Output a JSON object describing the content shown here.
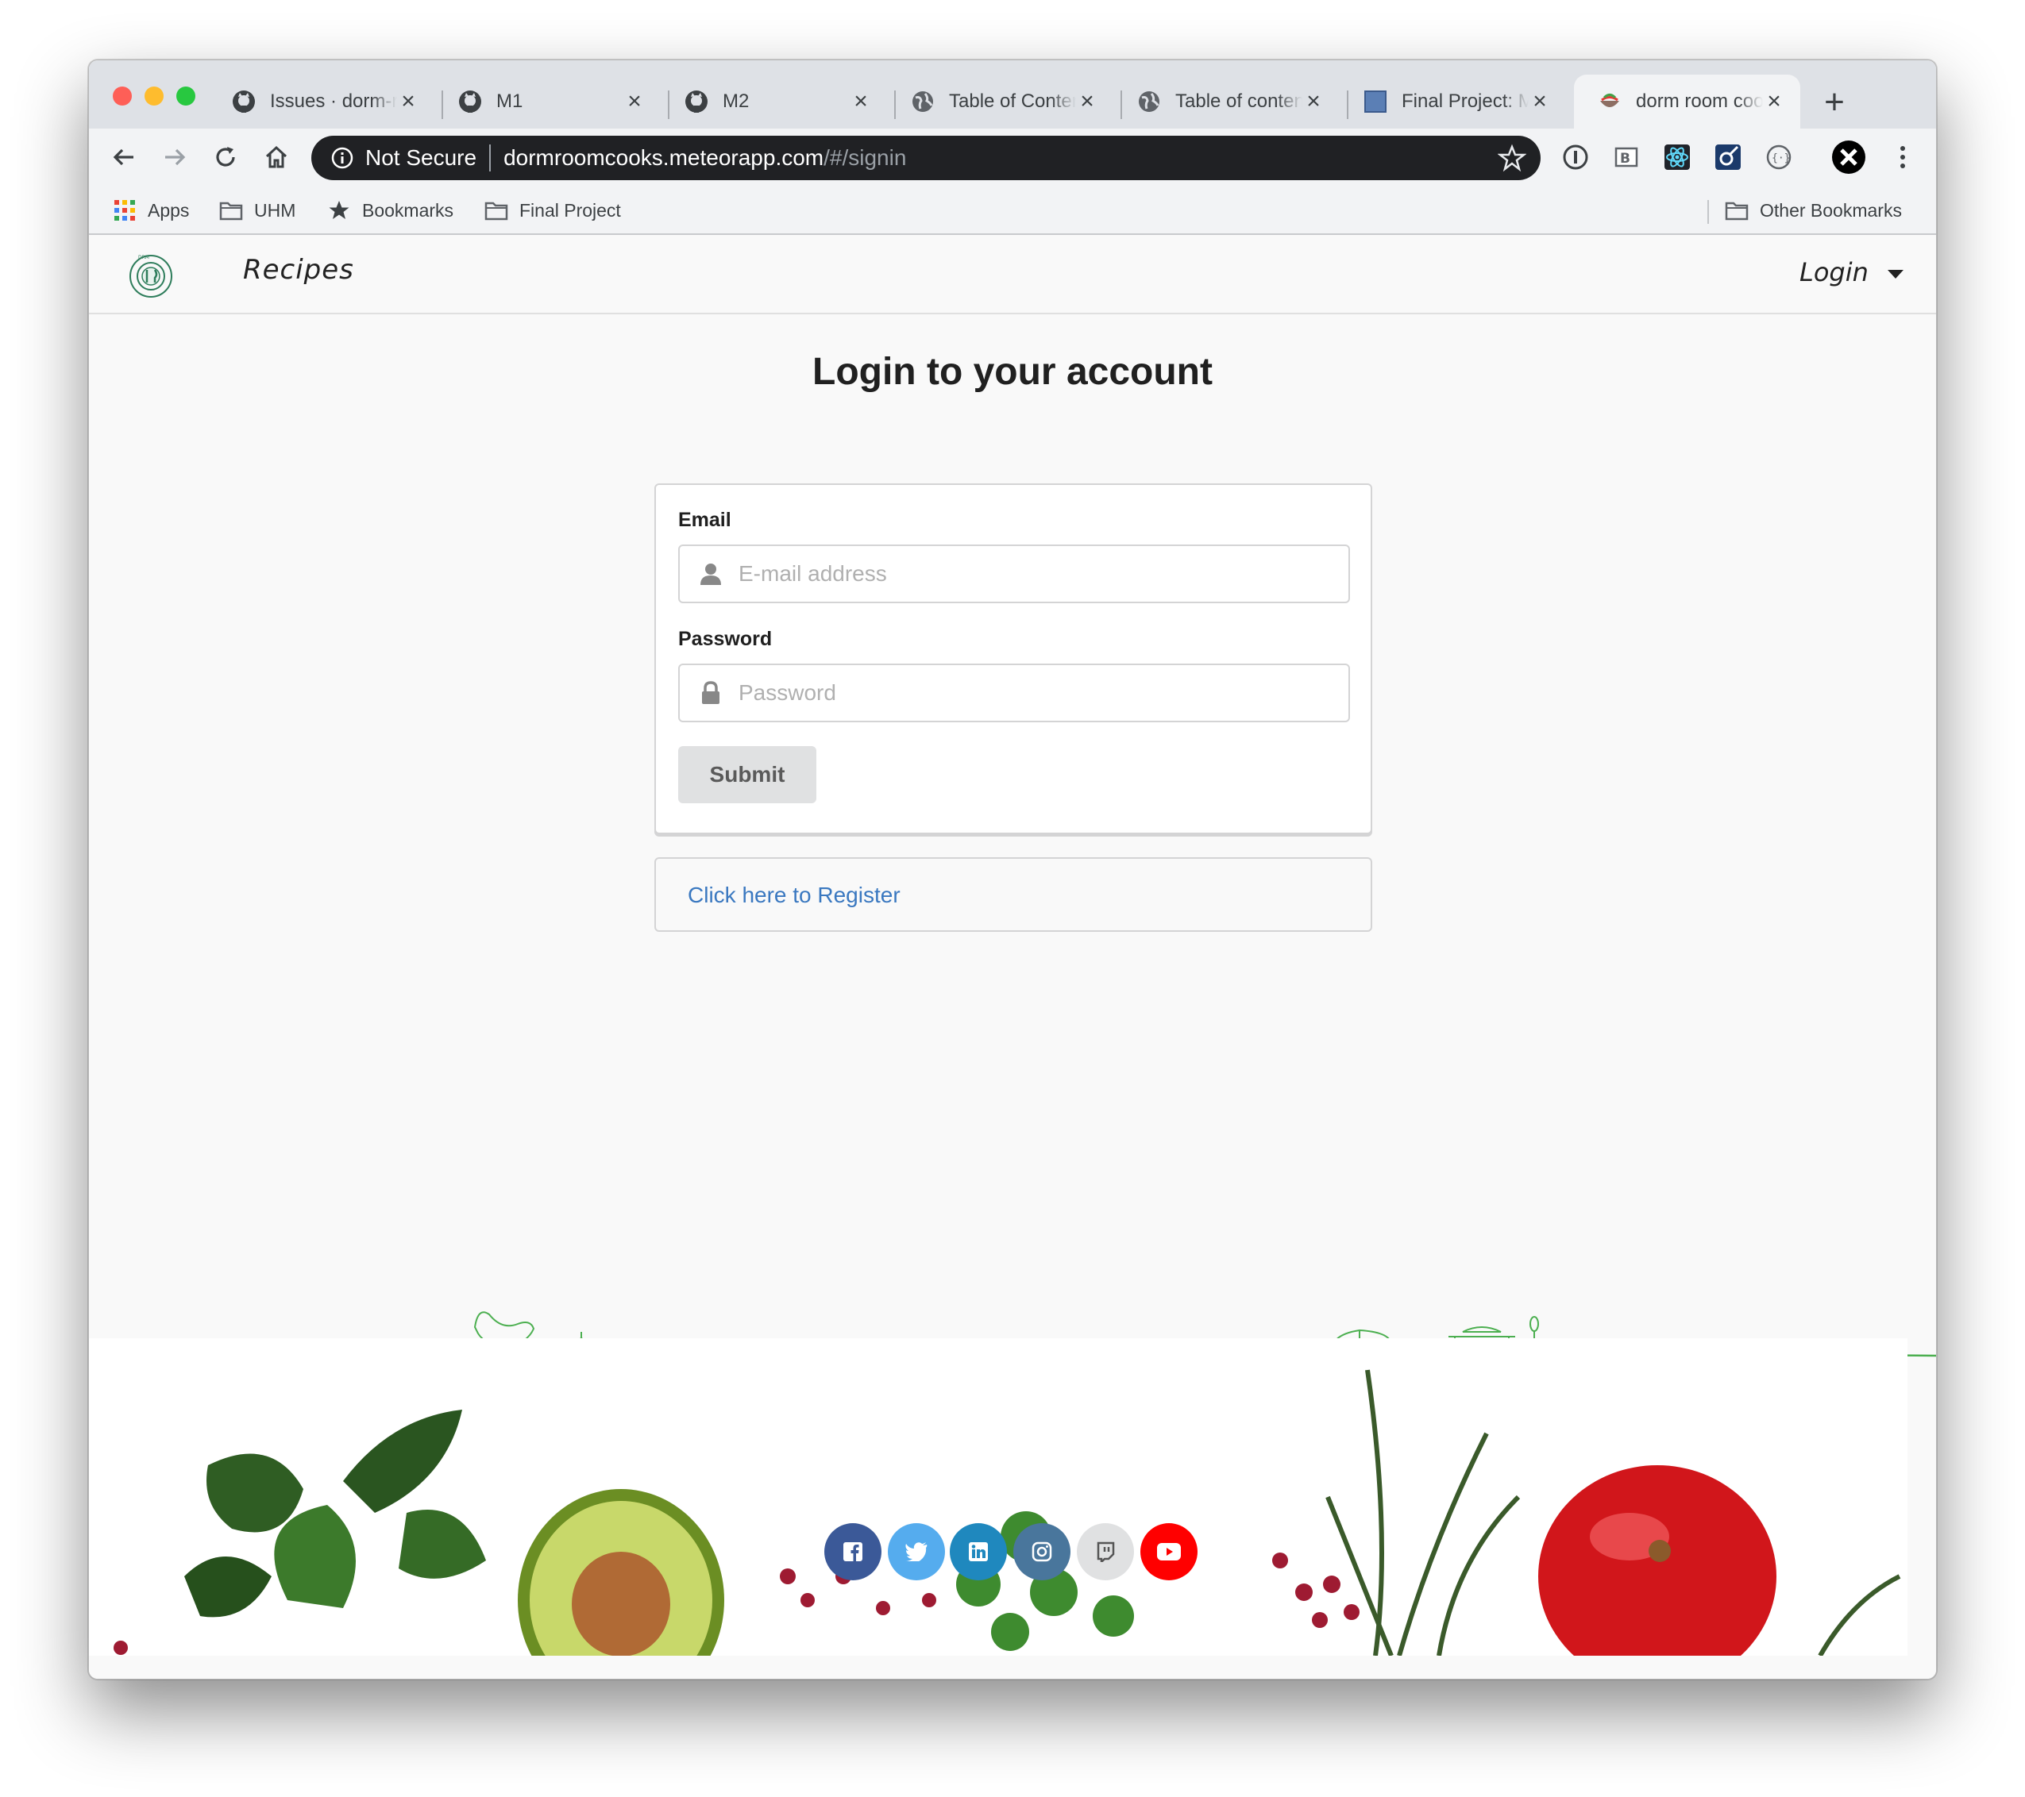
{
  "browser": {
    "tabs": [
      {
        "title": "Issues · dorm-room-cooks",
        "icon": "github-icon"
      },
      {
        "title": "M1",
        "icon": "github-icon"
      },
      {
        "title": "M2",
        "icon": "github-icon"
      },
      {
        "title": "Table of Contents",
        "icon": "globe-icon"
      },
      {
        "title": "Table of contents",
        "icon": "globe-icon"
      },
      {
        "title": "Final Project: M",
        "icon": "doc-icon"
      },
      {
        "title": "dorm room cooks",
        "icon": "bowl-icon",
        "active": true
      }
    ],
    "address": {
      "security_label": "Not Secure",
      "host": "dormroomcooks.meteorapp.com",
      "path": "/#/signin"
    },
    "bookmarks": [
      {
        "label": "Apps",
        "icon": "apps-grid-icon"
      },
      {
        "label": "UHM",
        "icon": "folder-icon"
      },
      {
        "label": "Bookmarks",
        "icon": "star-icon"
      },
      {
        "label": "Final Project",
        "icon": "folder-icon"
      }
    ],
    "other_bookmarks": "Other Bookmarks"
  },
  "site": {
    "nav": {
      "recipes": "Recipes",
      "login": "Login"
    },
    "title": "Login to your account",
    "form": {
      "email_label": "Email",
      "email_placeholder": "E-mail address",
      "password_label": "Password",
      "password_placeholder": "Password",
      "submit": "Submit"
    },
    "register_link": "Click here to Register",
    "social": [
      {
        "name": "facebook",
        "color": "#3b5998"
      },
      {
        "name": "twitter",
        "color": "#55acee"
      },
      {
        "name": "linkedin",
        "color": "#1f88be"
      },
      {
        "name": "instagram",
        "color": "#49769c"
      },
      {
        "name": "twitch",
        "color": "#e0e1e2"
      },
      {
        "name": "youtube",
        "color": "#ff0000"
      }
    ]
  },
  "colors": {
    "link": "#3a78c0",
    "button_bg": "#e0e1e2",
    "sketch_line": "#4caf50"
  }
}
